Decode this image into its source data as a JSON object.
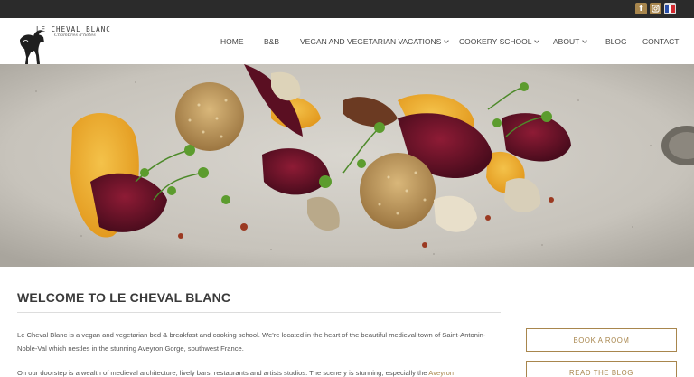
{
  "social": {
    "facebook_glyph": "f",
    "instagram_icon": "instagram-icon",
    "language_icon": "french-flag-icon",
    "accent_color": "#a8864d"
  },
  "brand": {
    "title": "LE CHEVAL BLANC",
    "subtitle": "Chambres d'hôtes"
  },
  "nav": {
    "items": [
      {
        "label": "HOME",
        "dropdown": false
      },
      {
        "label": "B&B",
        "dropdown": false
      },
      {
        "label": "VEGAN AND VEGETARIAN VACATIONS",
        "dropdown": true
      },
      {
        "label": "COOKERY SCHOOL",
        "dropdown": true
      },
      {
        "label": "ABOUT",
        "dropdown": true
      },
      {
        "label": "BLOG",
        "dropdown": false
      },
      {
        "label": "CONTACT",
        "dropdown": false
      }
    ]
  },
  "main": {
    "heading": "WELCOME TO LE CHEVAL BLANC",
    "paragraph1": "Le Cheval Blanc is a vegan and vegetarian bed & breakfast and cooking school.  We're located in the heart of the beautiful medieval town of Saint-Antonin-Noble-Val which nestles in the stunning Aveyron Gorge, southwest France.",
    "paragraph2_text": "On our doorstep is a wealth of medieval architecture, lively bars, restaurants and artists studios. The scenery is stunning, especially the ",
    "paragraph2_link": "Aveyron"
  },
  "buttons": {
    "book": "BOOK A ROOM",
    "blog": "READ THE BLOG"
  }
}
